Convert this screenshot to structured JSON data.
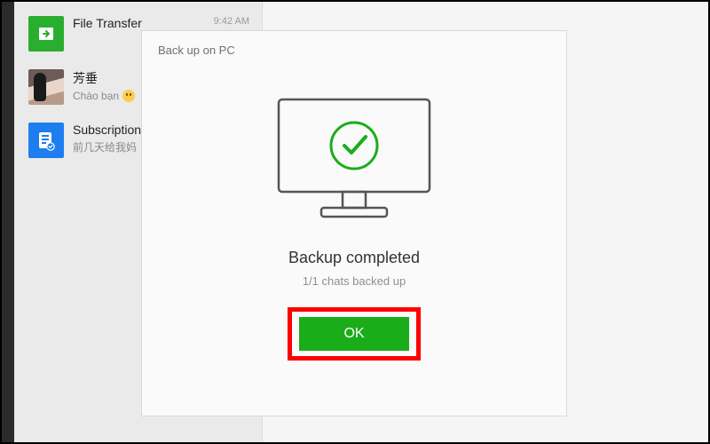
{
  "colors": {
    "accent_green": "#1aad19",
    "highlight_red": "#ff0000",
    "icon_blue": "#1e7ef0"
  },
  "chatlist": {
    "items": [
      {
        "name": "File Transfer",
        "preview": "",
        "time": "9:42 AM",
        "avatar": "green-file-transfer"
      },
      {
        "name": "芳垂",
        "preview": "Chào bạn",
        "time": "",
        "avatar": "photo",
        "has_emoji": true
      },
      {
        "name": "Subscriptions",
        "preview": "前几天给我妈",
        "time": "",
        "avatar": "blue-subscription"
      }
    ]
  },
  "dialog": {
    "title": "Back up on PC",
    "status_title": "Backup completed",
    "status_sub": "1/1 chats backed up",
    "ok_label": "OK"
  }
}
